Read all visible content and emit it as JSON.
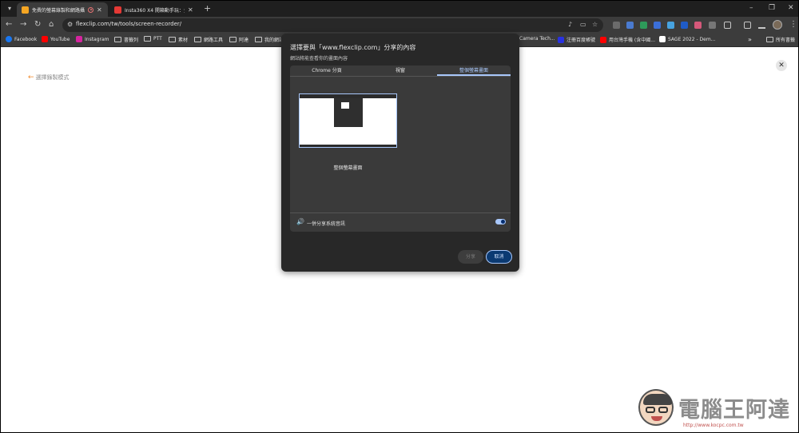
{
  "tabs": [
    {
      "title": "免費的螢幕錄製和網路攝影",
      "favicon_color": "#f5a623",
      "active": true
    },
    {
      "title": "Insta360 X4 開箱動手玩：全景",
      "favicon_color": "#e53935",
      "active": false
    }
  ],
  "address_bar": {
    "url": "flexclip.com/tw/tools/screen-recorder/"
  },
  "bookmarks": [
    {
      "label": "Facebook",
      "icon": "facebook-icon",
      "color": "#1877f2"
    },
    {
      "label": "YouTube",
      "icon": "youtube-icon",
      "color": "#ff0000"
    },
    {
      "label": "Instagram",
      "icon": "instagram-icon",
      "color": "#d6249f"
    },
    {
      "label": "書籤列",
      "icon": "folder-icon"
    },
    {
      "label": "PTT",
      "icon": "folder-icon"
    },
    {
      "label": "素材",
      "icon": "folder-icon"
    },
    {
      "label": "網路工具",
      "icon": "folder-icon"
    },
    {
      "label": "阿達",
      "icon": "folder-icon"
    },
    {
      "label": "我的網站",
      "icon": "folder-icon"
    },
    {
      "label": "Camera Tech...",
      "icon": "site-icon",
      "color": "#555555"
    },
    {
      "label": "注冊百度帳號",
      "icon": "baidu-icon",
      "color": "#2932e1"
    },
    {
      "label": "用台灣手機 (含中國...",
      "icon": "youtube-icon",
      "color": "#ff0000"
    },
    {
      "label": "SAGE 2022 - Dem...",
      "icon": "sage-icon",
      "color": "#ffffff"
    }
  ],
  "bookmarks_overflow": "»",
  "all_bookmarks": "所有書籤",
  "page": {
    "back_label": "選擇錄製模式"
  },
  "dialog": {
    "title": "選擇要與「www.flexclip.com」分享的內容",
    "subtitle": "網站將能查看你的畫面內容",
    "tabs": [
      "Chrome 分頁",
      "視窗",
      "整個螢幕畫面"
    ],
    "active_tab_index": 2,
    "screen_label": "整個螢幕畫面",
    "audio_label": "一併分享系統音訊",
    "audio_enabled": true,
    "share_button": "分享",
    "cancel_button": "取消"
  },
  "watermark": {
    "text": "電腦王阿達",
    "url": "http://www.kocpc.com.tw"
  }
}
